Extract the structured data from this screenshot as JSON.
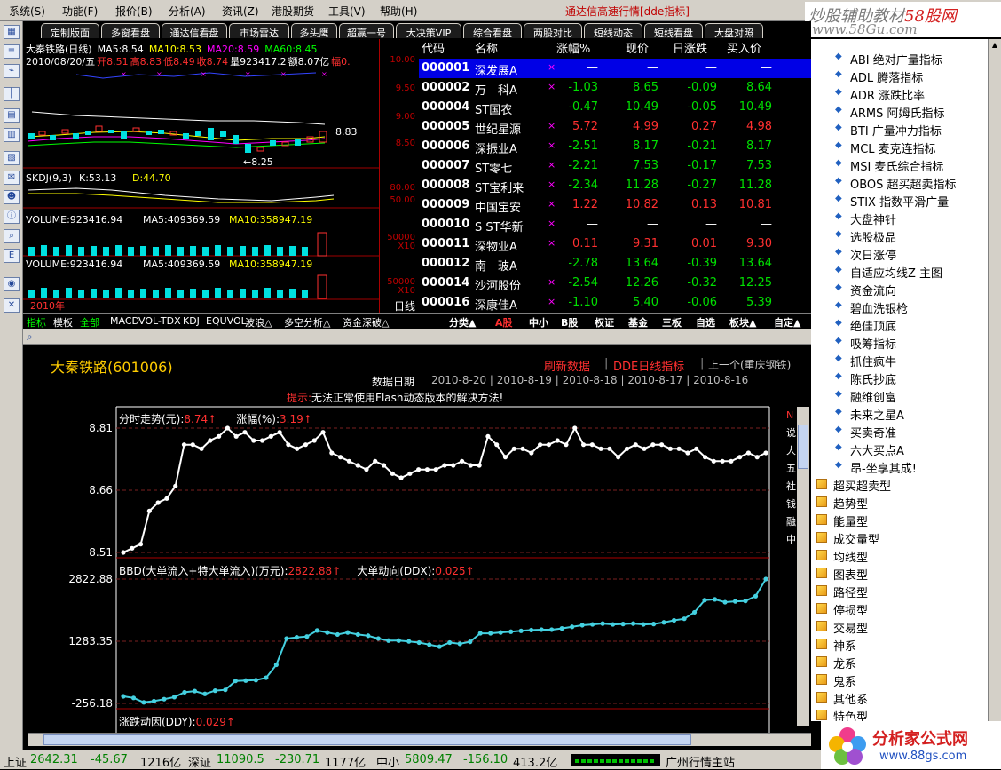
{
  "menu": [
    "系统(S)",
    "功能(F)",
    "报价(B)",
    "分析(A)",
    "资讯(Z)",
    "港股期货",
    "工具(V)",
    "帮助(H)"
  ],
  "app_title": "通达信高速行情[dde指标]",
  "brand": {
    "line1a": "炒股辅助教材",
    "line1b": "58股网",
    "line2": "www.58Gu.com"
  },
  "top_tabs": [
    "定制版面",
    "多窗看盘",
    "通达信看盘",
    "市场雷达",
    "多头鹰",
    "超赢一号",
    "大决策VIP",
    "综合看盘",
    "两股对比",
    "短线动态",
    "短线看盘",
    "大盘对照"
  ],
  "kline": {
    "title": "大秦铁路(日线)",
    "ma5": "MA5:8.54",
    "ma10": "MA10:8.53",
    "ma20": "MA20:8.59",
    "ma60": "MA60:8.45",
    "ohlc_date": "2010/08/20/五",
    "open": "开8.51",
    "high": "高8.83",
    "low": "低8.49",
    "close": "收8.74",
    "vol": "量923417.2",
    "amount": "额8.07亿",
    "amp": "幅0.",
    "hi_mark": "8.83",
    "lo_mark": "←8.25",
    "skdj": "SKDJ(9,3)",
    "skdj_k": "K:53.13",
    "skdj_d": "D:44.70",
    "volume": "VOLUME:923416.94",
    "vol_ma5": "MA5:409369.59",
    "vol_ma10": "MA10:358947.19",
    "year_label": "2010年",
    "right_scale": [
      "10.00",
      "9.50",
      "9.00",
      "8.50"
    ],
    "skdj_scale": [
      "80.00",
      "50.00"
    ],
    "vol_scale": [
      "50000",
      "X10",
      "50000",
      "X10"
    ],
    "period": "日线"
  },
  "stock_list": {
    "headers": [
      "代码",
      "名称",
      "涨幅%",
      "现价",
      "日涨跌",
      "买入价"
    ],
    "rows": [
      {
        "code": "000001",
        "name": "深发展A",
        "chg": "—",
        "price": "—",
        "diff": "—",
        "bid": "—",
        "up": 0,
        "sel": true
      },
      {
        "code": "000002",
        "name": "万　科A",
        "chg": "-1.03",
        "price": "8.65",
        "diff": "-0.09",
        "bid": "8.64",
        "up": -1
      },
      {
        "code": "000004",
        "name": "ST国农",
        "chg": "-0.47",
        "price": "10.49",
        "diff": "-0.05",
        "bid": "10.49",
        "up": -1
      },
      {
        "code": "000005",
        "name": "世纪星源",
        "chg": "5.72",
        "price": "4.99",
        "diff": "0.27",
        "bid": "4.98",
        "up": 1
      },
      {
        "code": "000006",
        "name": "深振业A",
        "chg": "-2.51",
        "price": "8.17",
        "diff": "-0.21",
        "bid": "8.17",
        "up": -1
      },
      {
        "code": "000007",
        "name": "ST零七",
        "chg": "-2.21",
        "price": "7.53",
        "diff": "-0.17",
        "bid": "7.53",
        "up": -1
      },
      {
        "code": "000008",
        "name": "ST宝利来",
        "chg": "-2.34",
        "price": "11.28",
        "diff": "-0.27",
        "bid": "11.28",
        "up": -1
      },
      {
        "code": "000009",
        "name": "中国宝安",
        "chg": "1.22",
        "price": "10.82",
        "diff": "0.13",
        "bid": "10.81",
        "up": 1
      },
      {
        "code": "000010",
        "name": "S ST华新",
        "chg": "—",
        "price": "—",
        "diff": "—",
        "bid": "—",
        "up": 0
      },
      {
        "code": "000011",
        "name": "深物业A",
        "chg": "0.11",
        "price": "9.31",
        "diff": "0.01",
        "bid": "9.30",
        "up": 1
      },
      {
        "code": "000012",
        "name": "南　玻A",
        "chg": "-2.78",
        "price": "13.64",
        "diff": "-0.39",
        "bid": "13.64",
        "up": -1
      },
      {
        "code": "000014",
        "name": "沙河股份",
        "chg": "-2.54",
        "price": "12.26",
        "diff": "-0.32",
        "bid": "12.25",
        "up": -1
      },
      {
        "code": "000016",
        "name": "深康佳A",
        "chg": "-1.10",
        "price": "5.40",
        "diff": "-0.06",
        "bid": "5.39",
        "up": -1
      }
    ]
  },
  "bottom_tabs": [
    "指标",
    "模板",
    "全部",
    "MACD",
    "VOL-TDX",
    "KDJ",
    "EQUVOL",
    "波浪△",
    "多空分析△",
    "资金深破△"
  ],
  "list_buttons": [
    "分类▲",
    "A股",
    "中小",
    "B股",
    "权证",
    "基金",
    "三板",
    "自选",
    "板块▲",
    "自定▲"
  ],
  "web": {
    "stock_title": "大秦铁路(601006)",
    "refresh": "刷新数据",
    "dde": "DDE日线指标",
    "prev": "上一个(重庆钢铁)",
    "date_label": "数据日期",
    "dates": [
      "2010-8-20",
      "2010-8-19",
      "2010-8-18",
      "2010-8-17",
      "2010-8-16"
    ],
    "tip_label": "提示:",
    "tip": "无法正常使用Flash动态版本的解决方法!",
    "intraday_label": "分时走势(元):",
    "intraday_val": "8.74↑",
    "pct_label": "涨幅(%):",
    "pct_val": "3.19↑",
    "bbd_label": "BBD(大单流入+特大单流入)(万元):",
    "bbd_val": "2822.88↑",
    "ddx_label": "大单动向(DDX):",
    "ddx_val": "0.025↑",
    "ddy_label": "涨跌动因(DDY):",
    "ddy_val": "0.029↑",
    "side_chars": [
      "说",
      "大",
      "五",
      "社",
      "钱",
      "融",
      "中"
    ],
    "side_top": "N"
  },
  "chart_data": [
    {
      "type": "line",
      "title": "分时走势(元)",
      "ylim": [
        8.51,
        8.81
      ],
      "yticks": [
        "8.81",
        "8.66",
        "8.51"
      ],
      "values": [
        8.51,
        8.52,
        8.53,
        8.61,
        8.63,
        8.64,
        8.67,
        8.77,
        8.77,
        8.76,
        8.78,
        8.79,
        8.81,
        8.79,
        8.8,
        8.78,
        8.78,
        8.79,
        8.8,
        8.77,
        8.76,
        8.77,
        8.78,
        8.8,
        8.75,
        8.74,
        8.73,
        8.72,
        8.71,
        8.73,
        8.72,
        8.7,
        8.69,
        8.7,
        8.71,
        8.71,
        8.71,
        8.72,
        8.72,
        8.73,
        8.72,
        8.72,
        8.79,
        8.77,
        8.74,
        8.76,
        8.76,
        8.75,
        8.77,
        8.77,
        8.78,
        8.77,
        8.81,
        8.77,
        8.77,
        8.76,
        8.76,
        8.74,
        8.76,
        8.77,
        8.76,
        8.77,
        8.77,
        8.76,
        8.76,
        8.75,
        8.76,
        8.74,
        8.73,
        8.73,
        8.73,
        8.74,
        8.75,
        8.74,
        8.75
      ]
    },
    {
      "type": "line",
      "title": "BBD(大单流入+特大单流入)(万元)",
      "ylim": [
        -256.18,
        2822.88
      ],
      "yticks": [
        "2822.88",
        "1283.35",
        "-256.18"
      ],
      "values": [
        -80,
        -120,
        -230,
        -200,
        -150,
        -100,
        20,
        50,
        -20,
        60,
        80,
        300,
        310,
        320,
        380,
        700,
        1350,
        1380,
        1400,
        1550,
        1500,
        1450,
        1500,
        1450,
        1420,
        1350,
        1300,
        1300,
        1280,
        1250,
        1200,
        1150,
        1250,
        1220,
        1270,
        1480,
        1480,
        1500,
        1520,
        1540,
        1560,
        1570,
        1570,
        1600,
        1640,
        1680,
        1700,
        1720,
        1700,
        1710,
        1720,
        1700,
        1710,
        1750,
        1800,
        1840,
        2000,
        2300,
        2320,
        2250,
        2270,
        2280,
        2400,
        2822.88
      ]
    }
  ],
  "tree": {
    "items": [
      {
        "label": "ABI 绝对广量指标",
        "kind": "leaf"
      },
      {
        "label": "ADL 腾落指标",
        "kind": "leaf"
      },
      {
        "label": "ADR 涨跌比率",
        "kind": "leaf"
      },
      {
        "label": "ARMS 阿姆氏指标",
        "kind": "leaf"
      },
      {
        "label": "BTI 广量冲力指标",
        "kind": "leaf"
      },
      {
        "label": "MCL 麦克连指标",
        "kind": "leaf"
      },
      {
        "label": "MSI 麦氏综合指标",
        "kind": "leaf"
      },
      {
        "label": "OBOS 超买超卖指标",
        "kind": "leaf"
      },
      {
        "label": "STIX 指数平滑广量",
        "kind": "leaf"
      },
      {
        "label": "大盘神针",
        "kind": "leaf"
      },
      {
        "label": "选股极品",
        "kind": "leaf"
      },
      {
        "label": "次日涨停",
        "kind": "leaf"
      },
      {
        "label": "自适应均线Z 主图",
        "kind": "leaf"
      },
      {
        "label": "资金流向",
        "kind": "leaf"
      },
      {
        "label": "碧血洗银枪",
        "kind": "leaf"
      },
      {
        "label": "绝佳顶底",
        "kind": "leaf"
      },
      {
        "label": "吸筹指标",
        "kind": "leaf"
      },
      {
        "label": "抓住疯牛",
        "kind": "leaf"
      },
      {
        "label": "陈氏抄底",
        "kind": "leaf"
      },
      {
        "label": "融维创富",
        "kind": "leaf"
      },
      {
        "label": "未来之星A",
        "kind": "leaf"
      },
      {
        "label": "买卖奇准",
        "kind": "leaf"
      },
      {
        "label": "六大买点A",
        "kind": "leaf"
      },
      {
        "label": "昂-坐享其成!",
        "kind": "leaf"
      },
      {
        "label": "超买超卖型",
        "kind": "folder"
      },
      {
        "label": "趋势型",
        "kind": "folder"
      },
      {
        "label": "能量型",
        "kind": "folder"
      },
      {
        "label": "成交量型",
        "kind": "folder"
      },
      {
        "label": "均线型",
        "kind": "folder"
      },
      {
        "label": "图表型",
        "kind": "folder"
      },
      {
        "label": "路径型",
        "kind": "folder"
      },
      {
        "label": "停损型",
        "kind": "folder"
      },
      {
        "label": "交易型",
        "kind": "folder"
      },
      {
        "label": "神系",
        "kind": "folder"
      },
      {
        "label": "龙系",
        "kind": "folder"
      },
      {
        "label": "鬼系",
        "kind": "folder"
      },
      {
        "label": "其他系",
        "kind": "folder"
      },
      {
        "label": "特色型",
        "kind": "folder"
      }
    ]
  },
  "status": {
    "sh_label": "上证",
    "sh_val": "2642.31",
    "sh_chg": "-45.67",
    "sh_amt": "1216亿",
    "sz_label": "深证",
    "sz_val": "11090.5",
    "sz_chg": "-230.71",
    "sz_amt": "1177亿",
    "zx_label": "中小",
    "zx_val": "5809.47",
    "zx_chg": "-156.10",
    "zx_amt": "413.2亿",
    "server": "广州行情主站"
  },
  "foot_logo": {
    "brand": "分析家公式网",
    "url": "www.88gs.com"
  },
  "colors": {
    "up": "#ff3030",
    "down": "#00e000",
    "accent": "#ff0000",
    "select": "#0000e6",
    "cyan": "#44d0e0"
  }
}
